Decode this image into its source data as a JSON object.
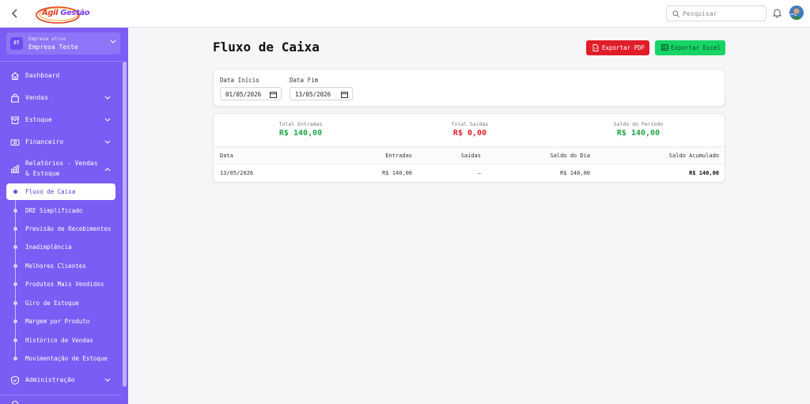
{
  "app": {
    "logo_text_prefix": "Ágil",
    "logo_text_suffix": " Gestão"
  },
  "header": {
    "search_placeholder": "Pesquisar"
  },
  "sidebar": {
    "company_badge": "ET",
    "company_caption": "Empresa ativa",
    "company_name": "Empresa Teste",
    "items": [
      {
        "label": "Dashboard"
      },
      {
        "label": "Vendas"
      },
      {
        "label": "Estoque"
      },
      {
        "label": "Financeiro"
      },
      {
        "label": "Relatórios - Vendas & Estoque"
      },
      {
        "label": "Administração"
      }
    ],
    "subitems": [
      {
        "label": "Fluxo de Caixa"
      },
      {
        "label": "DRE Simplificado"
      },
      {
        "label": "Previsão de Recebimentos"
      },
      {
        "label": "Inadimplência"
      },
      {
        "label": "Melhores Clientes"
      },
      {
        "label": "Produtos Mais Vendidos"
      },
      {
        "label": "Giro de Estoque"
      },
      {
        "label": "Margem por Produto"
      },
      {
        "label": "Histórico de Vendas"
      },
      {
        "label": "Movimentação de Estoque"
      }
    ]
  },
  "main": {
    "title": "Fluxo de Caixa",
    "export_pdf_label": "Exportar PDF",
    "export_excel_label": "Exportar Excel",
    "filters": {
      "start_label": "Data Início",
      "start_value": "01/05/2026",
      "end_label": "Data Fim",
      "end_value": "13/05/2026"
    },
    "summary": {
      "entradas_label": "Total Entradas",
      "entradas_value": "R$ 140,00",
      "saidas_label": "Total Saídas",
      "saidas_value": "R$ 0,00",
      "saldo_label": "Saldo do Período",
      "saldo_value": "R$ 140,00"
    },
    "table": {
      "columns": [
        "Data",
        "Entradas",
        "Saídas",
        "Saldo do Dia",
        "Saldo Acumulado"
      ],
      "rows": [
        [
          "13/05/2026",
          "R$ 140,00",
          "—",
          "R$ 140,00",
          "R$ 140,00"
        ]
      ]
    }
  },
  "colors": {
    "sidebar_bg": "#7b5cf5",
    "accent": "#6a4df0",
    "pdf_button": "#e11d2a",
    "excel_button": "#16d466",
    "positive": "#1fa64a",
    "negative": "#e11d2a"
  }
}
